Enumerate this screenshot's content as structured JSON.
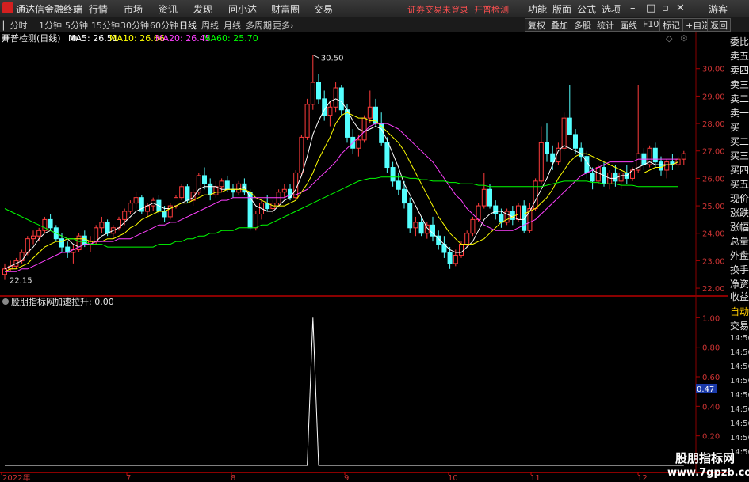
{
  "app": {
    "title": "通达信金融终端",
    "menu": [
      "行情",
      "市场",
      "资讯",
      "发现",
      "问小达",
      "财富圈",
      "交易"
    ],
    "warning": "证券交易未登录",
    "indicator_name": "开普检测",
    "right_menu": [
      "功能",
      "版面",
      "公式",
      "选项"
    ],
    "guest": "游客"
  },
  "periods": [
    "分时",
    "1分钟",
    "5分钟",
    "15分钟",
    "30分钟",
    "60分钟",
    "日线",
    "周线",
    "月线",
    "多周期",
    "更多"
  ],
  "active_period": "日线",
  "tools": [
    "复权",
    "叠加",
    "多股",
    "统计",
    "画线",
    "F10",
    "标记",
    "+自选",
    "返回"
  ],
  "main_chart": {
    "title": "开普检测(日线)",
    "ma": [
      {
        "label": "MA5: 26.51",
        "color": "#ffffff"
      },
      {
        "label": "MA10: 26.66",
        "color": "#ffff00"
      },
      {
        "label": "MA20: 26.45",
        "color": "#ff40ff"
      },
      {
        "label": "MA60: 25.70",
        "color": "#00ff00"
      }
    ],
    "high_label": "30.50",
    "low_label": "22.15",
    "y_ticks": [
      "30.00",
      "29.00",
      "28.00",
      "27.00",
      "26.00",
      "25.00",
      "24.00",
      "23.00",
      "22.00"
    ]
  },
  "sub_chart": {
    "title": "股朋指标网",
    "value_label": "加速拉升: 0.00",
    "y_ticks": [
      "1.00",
      "0.80",
      "0.60",
      "0.40",
      "0.20"
    ],
    "cursor_value": "0.47"
  },
  "time_axis": [
    "2022年",
    "7",
    "8",
    "9",
    "10",
    "11",
    "12"
  ],
  "side_panel": {
    "items": [
      "委比",
      "卖五",
      "卖四",
      "卖三",
      "卖二",
      "卖一",
      "买一",
      "买二",
      "买三",
      "买四",
      "买五",
      "现价",
      "涨跌",
      "涨幅",
      "总量",
      "外盘",
      "换手",
      "净资",
      "收益"
    ],
    "items2": [
      "自动",
      "交易"
    ],
    "times": [
      "14:56",
      "14:56",
      "14:56",
      "14:56",
      "14:56",
      "14:56",
      "14:56",
      "14:56",
      "14:56"
    ]
  },
  "watermark": {
    "line1": "股朋指标网",
    "line2": "www.7gpzb.com"
  },
  "chart_data": {
    "type": "candlestick",
    "ylim": [
      21.8,
      30.8
    ],
    "up_color": "#ff3c3c",
    "down_color": "#54ffff",
    "candles": [
      [
        22.5,
        22.9,
        22.3,
        22.7
      ],
      [
        22.7,
        23.0,
        22.6,
        22.8
      ],
      [
        22.8,
        23.1,
        22.7,
        23.0
      ],
      [
        23.0,
        23.4,
        22.9,
        23.3
      ],
      [
        23.3,
        23.9,
        23.2,
        23.8
      ],
      [
        23.8,
        24.1,
        23.6,
        23.9
      ],
      [
        23.9,
        24.2,
        23.7,
        24.1
      ],
      [
        24.1,
        24.6,
        24.0,
        24.5
      ],
      [
        24.5,
        24.7,
        24.1,
        24.2
      ],
      [
        24.2,
        24.3,
        23.7,
        23.8
      ],
      [
        23.8,
        24.0,
        23.3,
        23.5
      ],
      [
        23.5,
        23.7,
        23.1,
        23.3
      ],
      [
        23.3,
        23.6,
        22.9,
        23.4
      ],
      [
        23.4,
        24.0,
        23.3,
        23.9
      ],
      [
        23.9,
        24.1,
        23.5,
        23.6
      ],
      [
        23.6,
        23.9,
        23.3,
        23.7
      ],
      [
        23.7,
        24.3,
        23.6,
        24.2
      ],
      [
        24.2,
        24.6,
        24.0,
        24.4
      ],
      [
        24.4,
        24.5,
        23.9,
        24.0
      ],
      [
        24.0,
        24.3,
        23.8,
        24.2
      ],
      [
        24.2,
        24.6,
        24.1,
        24.5
      ],
      [
        24.5,
        24.9,
        24.3,
        24.8
      ],
      [
        24.8,
        25.2,
        24.7,
        25.1
      ],
      [
        25.1,
        25.5,
        24.9,
        25.3
      ],
      [
        25.3,
        25.4,
        24.7,
        24.8
      ],
      [
        24.8,
        25.1,
        24.6,
        25.0
      ],
      [
        25.0,
        25.3,
        24.8,
        25.2
      ],
      [
        25.2,
        25.4,
        24.7,
        24.8
      ],
      [
        24.8,
        25.0,
        24.4,
        24.6
      ],
      [
        24.6,
        25.1,
        24.5,
        25.0
      ],
      [
        25.0,
        25.4,
        24.9,
        25.3
      ],
      [
        25.3,
        25.8,
        25.2,
        25.7
      ],
      [
        25.7,
        25.8,
        25.1,
        25.2
      ],
      [
        25.2,
        25.6,
        25.0,
        25.5
      ],
      [
        25.5,
        26.2,
        25.4,
        26.1
      ],
      [
        26.1,
        26.4,
        25.6,
        25.8
      ],
      [
        25.8,
        26.0,
        25.2,
        25.4
      ],
      [
        25.4,
        25.9,
        25.3,
        25.7
      ],
      [
        25.7,
        26.0,
        25.5,
        25.9
      ],
      [
        25.9,
        26.1,
        25.5,
        25.6
      ],
      [
        25.6,
        25.8,
        25.3,
        25.5
      ],
      [
        25.5,
        25.9,
        25.4,
        25.8
      ],
      [
        25.8,
        26.0,
        25.4,
        25.5
      ],
      [
        25.5,
        25.6,
        24.1,
        24.2
      ],
      [
        24.2,
        24.8,
        24.1,
        24.7
      ],
      [
        24.7,
        25.2,
        24.5,
        25.1
      ],
      [
        25.1,
        25.4,
        24.8,
        24.9
      ],
      [
        24.9,
        25.2,
        24.7,
        25.1
      ],
      [
        25.1,
        25.6,
        25.0,
        25.5
      ],
      [
        25.5,
        25.8,
        25.3,
        25.6
      ],
      [
        25.6,
        25.8,
        25.2,
        25.3
      ],
      [
        25.3,
        26.3,
        25.2,
        26.2
      ],
      [
        26.2,
        27.6,
        26.1,
        27.5
      ],
      [
        27.5,
        28.9,
        27.4,
        28.7
      ],
      [
        28.7,
        30.5,
        28.5,
        29.5
      ],
      [
        29.5,
        29.8,
        28.7,
        28.9
      ],
      [
        28.9,
        29.2,
        28.1,
        28.3
      ],
      [
        28.3,
        28.8,
        27.9,
        28.6
      ],
      [
        28.6,
        29.5,
        28.4,
        29.3
      ],
      [
        29.3,
        29.4,
        28.3,
        28.5
      ],
      [
        28.5,
        28.7,
        27.3,
        27.5
      ],
      [
        27.5,
        27.8,
        26.9,
        27.1
      ],
      [
        27.1,
        27.6,
        26.8,
        27.4
      ],
      [
        27.4,
        28.3,
        27.3,
        28.2
      ],
      [
        28.2,
        29.2,
        28.0,
        28.6
      ],
      [
        28.6,
        28.9,
        27.9,
        28.0
      ],
      [
        28.0,
        28.4,
        27.2,
        27.3
      ],
      [
        27.3,
        27.5,
        26.2,
        26.4
      ],
      [
        26.4,
        26.6,
        25.7,
        25.9
      ],
      [
        25.9,
        26.2,
        25.4,
        25.6
      ],
      [
        25.6,
        25.9,
        24.9,
        25.1
      ],
      [
        25.1,
        25.3,
        24.0,
        24.2
      ],
      [
        24.2,
        24.6,
        23.9,
        24.4
      ],
      [
        24.4,
        24.6,
        23.9,
        24.0
      ],
      [
        24.0,
        24.4,
        23.8,
        24.3
      ],
      [
        24.3,
        24.6,
        23.7,
        23.9
      ],
      [
        23.9,
        24.1,
        23.4,
        23.6
      ],
      [
        23.6,
        23.9,
        23.1,
        23.3
      ],
      [
        23.3,
        23.5,
        22.7,
        22.9
      ],
      [
        22.9,
        23.4,
        22.8,
        23.2
      ],
      [
        23.2,
        23.7,
        23.1,
        23.6
      ],
      [
        23.6,
        24.1,
        23.5,
        24.0
      ],
      [
        24.0,
        24.6,
        23.9,
        24.5
      ],
      [
        24.5,
        25.1,
        24.4,
        25.0
      ],
      [
        25.0,
        26.2,
        24.9,
        25.6
      ],
      [
        25.6,
        25.8,
        24.9,
        25.0
      ],
      [
        25.0,
        25.2,
        24.5,
        24.7
      ],
      [
        24.7,
        24.9,
        24.2,
        24.4
      ],
      [
        24.4,
        24.9,
        24.3,
        24.8
      ],
      [
        24.8,
        25.0,
        24.3,
        24.5
      ],
      [
        24.5,
        25.1,
        24.4,
        25.0
      ],
      [
        25.0,
        25.2,
        24.0,
        24.1
      ],
      [
        24.1,
        25.1,
        24.0,
        24.9
      ],
      [
        24.9,
        26.0,
        24.8,
        25.9
      ],
      [
        25.9,
        27.9,
        25.8,
        27.3
      ],
      [
        27.3,
        28.0,
        26.6,
        26.9
      ],
      [
        26.9,
        27.2,
        26.3,
        26.6
      ],
      [
        26.6,
        27.3,
        26.5,
        27.1
      ],
      [
        27.1,
        28.4,
        27.0,
        28.2
      ],
      [
        28.2,
        29.4,
        27.9,
        27.6
      ],
      [
        27.6,
        27.8,
        26.9,
        27.1
      ],
      [
        27.1,
        27.3,
        26.6,
        26.8
      ],
      [
        26.8,
        27.0,
        26.0,
        26.2
      ],
      [
        26.2,
        26.4,
        25.6,
        25.9
      ],
      [
        25.9,
        26.5,
        25.8,
        26.4
      ],
      [
        26.4,
        26.6,
        25.7,
        25.8
      ],
      [
        25.8,
        26.3,
        25.6,
        26.2
      ],
      [
        26.2,
        26.5,
        25.7,
        25.9
      ],
      [
        25.9,
        26.3,
        25.6,
        26.2
      ],
      [
        26.2,
        26.5,
        25.8,
        26.0
      ],
      [
        26.0,
        26.4,
        25.9,
        26.3
      ],
      [
        26.3,
        29.4,
        26.2,
        26.9
      ],
      [
        26.9,
        27.1,
        26.3,
        26.5
      ],
      [
        26.5,
        27.2,
        26.4,
        27.1
      ],
      [
        27.1,
        27.3,
        26.4,
        26.6
      ],
      [
        26.6,
        26.8,
        26.1,
        26.3
      ],
      [
        26.3,
        26.7,
        26.0,
        26.6
      ],
      [
        26.6,
        26.9,
        26.3,
        26.5
      ],
      [
        26.5,
        26.8,
        26.4,
        26.7
      ],
      [
        26.7,
        27.0,
        26.5,
        26.9
      ]
    ],
    "series": [
      {
        "name": "MA5",
        "color": "#ffffff",
        "values": [
          22.7,
          22.8,
          22.9,
          23.0,
          23.3,
          23.5,
          23.8,
          24.0,
          24.1,
          24.0,
          23.9,
          23.8,
          23.6,
          23.5,
          23.6,
          23.6,
          23.7,
          23.9,
          24.0,
          24.1,
          24.2,
          24.4,
          24.6,
          24.8,
          24.9,
          25.0,
          25.1,
          25.0,
          24.9,
          24.9,
          25.0,
          25.1,
          25.2,
          25.3,
          25.6,
          25.7,
          25.7,
          25.7,
          25.6,
          25.6,
          25.6,
          25.6,
          25.7,
          25.3,
          25.0,
          24.9,
          24.8,
          24.8,
          25.0,
          25.2,
          25.3,
          25.6,
          26.1,
          26.8,
          27.6,
          28.1,
          28.5,
          28.8,
          28.9,
          28.8,
          28.5,
          28.1,
          27.8,
          27.7,
          27.8,
          27.9,
          27.8,
          27.4,
          26.9,
          26.4,
          25.8,
          25.4,
          25.0,
          24.6,
          24.2,
          24.0,
          23.8,
          23.6,
          23.4,
          23.3,
          23.3,
          23.5,
          23.7,
          24.1,
          24.5,
          24.7,
          24.8,
          24.8,
          24.7,
          24.6,
          24.5,
          24.5,
          24.8,
          25.2,
          25.6,
          26.0,
          26.5,
          27.0,
          27.2,
          27.1,
          27.0,
          26.9,
          26.6,
          26.3,
          26.2,
          26.1,
          26.0,
          26.0,
          26.1,
          26.1,
          26.3,
          26.4,
          26.5,
          26.6,
          26.5,
          26.5,
          26.5,
          26.5,
          26.6
        ]
      },
      {
        "name": "MA10",
        "color": "#ffff00",
        "values": [
          22.6,
          22.7,
          22.7,
          22.8,
          22.9,
          23.1,
          23.3,
          23.5,
          23.6,
          23.7,
          23.7,
          23.8,
          23.8,
          23.8,
          23.8,
          23.7,
          23.7,
          23.7,
          23.8,
          23.8,
          23.9,
          24.0,
          24.2,
          24.3,
          24.5,
          24.6,
          24.7,
          24.8,
          24.8,
          24.9,
          25.0,
          25.1,
          25.1,
          25.2,
          25.3,
          25.4,
          25.4,
          25.5,
          25.5,
          25.6,
          25.6,
          25.6,
          25.6,
          25.5,
          25.3,
          25.2,
          25.1,
          25.0,
          25.0,
          25.0,
          25.1,
          25.2,
          25.5,
          25.8,
          26.2,
          26.7,
          27.1,
          27.5,
          28.0,
          28.3,
          28.4,
          28.3,
          28.2,
          28.2,
          28.1,
          28.1,
          27.9,
          27.7,
          27.5,
          27.3,
          27.0,
          26.6,
          26.2,
          25.8,
          25.4,
          25.0,
          24.6,
          24.3,
          24.0,
          23.8,
          23.6,
          23.6,
          23.6,
          23.7,
          23.8,
          24.0,
          24.2,
          24.4,
          24.5,
          24.6,
          24.7,
          24.7,
          24.8,
          24.9,
          25.1,
          25.3,
          25.6,
          26.0,
          26.3,
          26.6,
          26.8,
          26.9,
          26.9,
          26.8,
          26.7,
          26.6,
          26.5,
          26.4,
          26.3,
          26.2,
          26.2,
          26.2,
          26.2,
          26.3,
          26.4,
          26.4,
          26.5,
          26.5,
          26.6
        ]
      },
      {
        "name": "MA20",
        "color": "#ff40ff",
        "values": [
          22.6,
          22.6,
          22.6,
          22.7,
          22.7,
          22.8,
          22.9,
          23.0,
          23.1,
          23.2,
          23.3,
          23.3,
          23.4,
          23.5,
          23.6,
          23.6,
          23.7,
          23.7,
          23.7,
          23.7,
          23.8,
          23.8,
          23.8,
          23.9,
          24.0,
          24.1,
          24.2,
          24.3,
          24.3,
          24.4,
          24.4,
          24.5,
          24.6,
          24.7,
          24.8,
          24.9,
          25.0,
          25.1,
          25.2,
          25.2,
          25.3,
          25.3,
          25.3,
          25.3,
          25.3,
          25.3,
          25.3,
          25.3,
          25.3,
          25.3,
          25.4,
          25.4,
          25.5,
          25.6,
          25.8,
          26.0,
          26.2,
          26.4,
          26.6,
          26.9,
          27.1,
          27.3,
          27.5,
          27.7,
          27.9,
          28.0,
          28.0,
          28.0,
          27.9,
          27.8,
          27.6,
          27.4,
          27.2,
          27.0,
          26.8,
          26.6,
          26.3,
          26.0,
          25.7,
          25.4,
          25.2,
          24.9,
          24.7,
          24.5,
          24.3,
          24.2,
          24.1,
          24.1,
          24.1,
          24.1,
          24.2,
          24.3,
          24.4,
          24.5,
          24.7,
          24.9,
          25.1,
          25.3,
          25.5,
          25.7,
          25.9,
          26.1,
          26.2,
          26.3,
          26.4,
          26.5,
          26.6,
          26.6,
          26.6,
          26.6,
          26.6,
          26.7,
          26.7,
          26.7,
          26.7,
          26.7,
          26.7,
          26.7,
          26.7
        ]
      },
      {
        "name": "MA60",
        "color": "#00ff00",
        "values": [
          24.9,
          24.8,
          24.7,
          24.6,
          24.5,
          24.4,
          24.3,
          24.2,
          24.1,
          24.0,
          23.9,
          23.8,
          23.8,
          23.7,
          23.7,
          23.6,
          23.6,
          23.6,
          23.5,
          23.5,
          23.5,
          23.5,
          23.5,
          23.5,
          23.5,
          23.5,
          23.5,
          23.6,
          23.6,
          23.6,
          23.7,
          23.7,
          23.8,
          23.8,
          23.9,
          23.9,
          24.0,
          24.0,
          24.1,
          24.1,
          24.1,
          24.2,
          24.2,
          24.2,
          24.2,
          24.3,
          24.3,
          24.4,
          24.5,
          24.6,
          24.7,
          24.8,
          24.9,
          25.0,
          25.1,
          25.2,
          25.3,
          25.4,
          25.5,
          25.6,
          25.7,
          25.8,
          25.9,
          25.95,
          26.0,
          26.0,
          26.05,
          26.05,
          26.05,
          26.05,
          26.05,
          26.0,
          26.0,
          25.95,
          25.95,
          25.9,
          25.9,
          25.9,
          25.85,
          25.85,
          25.8,
          25.8,
          25.8,
          25.75,
          25.75,
          25.7,
          25.7,
          25.7,
          25.7,
          25.7,
          25.7,
          25.7,
          25.7,
          25.7,
          25.7,
          25.75,
          25.8,
          25.85,
          25.9,
          25.9,
          25.9,
          25.9,
          25.9,
          25.85,
          25.85,
          25.8,
          25.8,
          25.8,
          25.75,
          25.75,
          25.75,
          25.7,
          25.7,
          25.7,
          25.7,
          25.7,
          25.7,
          25.7,
          25.7
        ]
      }
    ],
    "indicator": {
      "name": "加速拉升",
      "ylim": [
        0,
        1.05
      ],
      "spike_index": 54,
      "spike_value": 1.0
    }
  }
}
